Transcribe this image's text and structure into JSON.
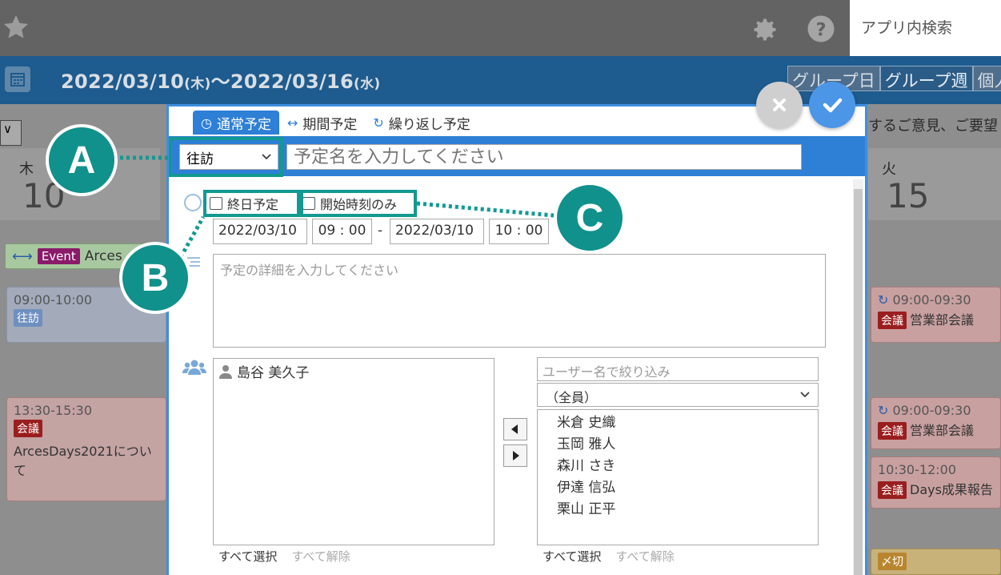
{
  "header": {
    "app_search_label": "アプリ内検索"
  },
  "calendar": {
    "date_start": "2022/03/10",
    "date_start_dow": "(木)",
    "date_sep": "～",
    "date_end": "2022/03/16",
    "date_end_dow": "(水)",
    "view_buttons": [
      "グループ日",
      "グループ週",
      "個人"
    ],
    "notice": "するご意見、ご要望",
    "select_arrow": "∨",
    "day_thu": {
      "dow": "木",
      "num": "10"
    },
    "day_tue": {
      "dow": "火",
      "num": "15"
    },
    "event_bar": {
      "arrow": "⟷",
      "tag": "Event",
      "title": "Arces"
    },
    "cards": [
      {
        "time": "09:00-10:00",
        "tag": "往訪",
        "title": ""
      },
      {
        "time": "13:30-15:30",
        "tag": "会議",
        "title": "ArcesDays2021について"
      },
      {
        "time": "09:00-09:30",
        "tag": "会議",
        "title": "営業部会議"
      },
      {
        "time": "09:00-09:30",
        "tag": "会議",
        "title": "営業部会議"
      },
      {
        "time": "10:30-12:00",
        "tag": "会議",
        "title": "Days成果報告"
      },
      {
        "time": "",
        "tag": "〆切",
        "title": ""
      }
    ]
  },
  "dialog": {
    "tabs": [
      {
        "label": "通常予定",
        "icon": "clock-icon"
      },
      {
        "label": "期間予定",
        "icon": "double-arrow-icon"
      },
      {
        "label": "繰り返し予定",
        "icon": "repeat-icon"
      }
    ],
    "type_select": "往訪",
    "title_placeholder": "予定名を入力してください",
    "allday_label": "終日予定",
    "startonly_label": "開始時刻のみ",
    "start_date": "2022/03/10",
    "start_time": "09 : 00",
    "dash": "-",
    "end_date": "2022/03/10",
    "end_time": "10 : 00",
    "detail_placeholder": "予定の詳細を入力してください",
    "participants": [
      "島谷 美久子"
    ],
    "user_filter_placeholder": "ユーザー名で絞り込み",
    "group_select": "（全員）",
    "users": [
      "米倉 史織",
      "玉岡 雅人",
      "森川 さき",
      "伊達 信弘",
      "栗山 正平"
    ],
    "select_all": "すべて選択",
    "deselect_all": "すべて解除"
  },
  "annotations": {
    "a": "A",
    "b": "B",
    "c": "C"
  },
  "colors": {
    "accent": "#2e7fd6",
    "callout": "#10918c",
    "header_blue": "#1e5b8e"
  }
}
